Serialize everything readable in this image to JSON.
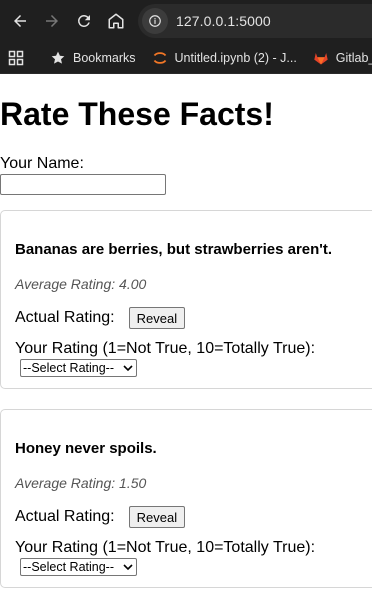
{
  "browser": {
    "url": "127.0.0.1:5000",
    "bookmarks": [
      {
        "label": "Bookmarks",
        "icon": "star-icon"
      },
      {
        "label": "Untitled.ipynb (2) - J...",
        "icon": "jupyter-icon"
      },
      {
        "label": "Gitlab_syn",
        "icon": "gitlab-icon"
      }
    ]
  },
  "page": {
    "title": "Rate These Facts!",
    "name_label": "Your Name:",
    "name_value": ""
  },
  "facts": [
    {
      "text": "Bananas are berries, but strawberries aren't.",
      "avg_label": "Average Rating:",
      "avg_value": "4.00",
      "actual_label": "Actual Rating:",
      "reveal_label": "Reveal",
      "your_rating_label": "Your Rating (1=Not True, 10=Totally True):",
      "select_value": "--Select Rating--"
    },
    {
      "text": "Honey never spoils.",
      "avg_label": "Average Rating:",
      "avg_value": "1.50",
      "actual_label": "Actual Rating:",
      "reveal_label": "Reveal",
      "your_rating_label": "Your Rating (1=Not True, 10=Totally True):",
      "select_value": "--Select Rating--"
    }
  ]
}
